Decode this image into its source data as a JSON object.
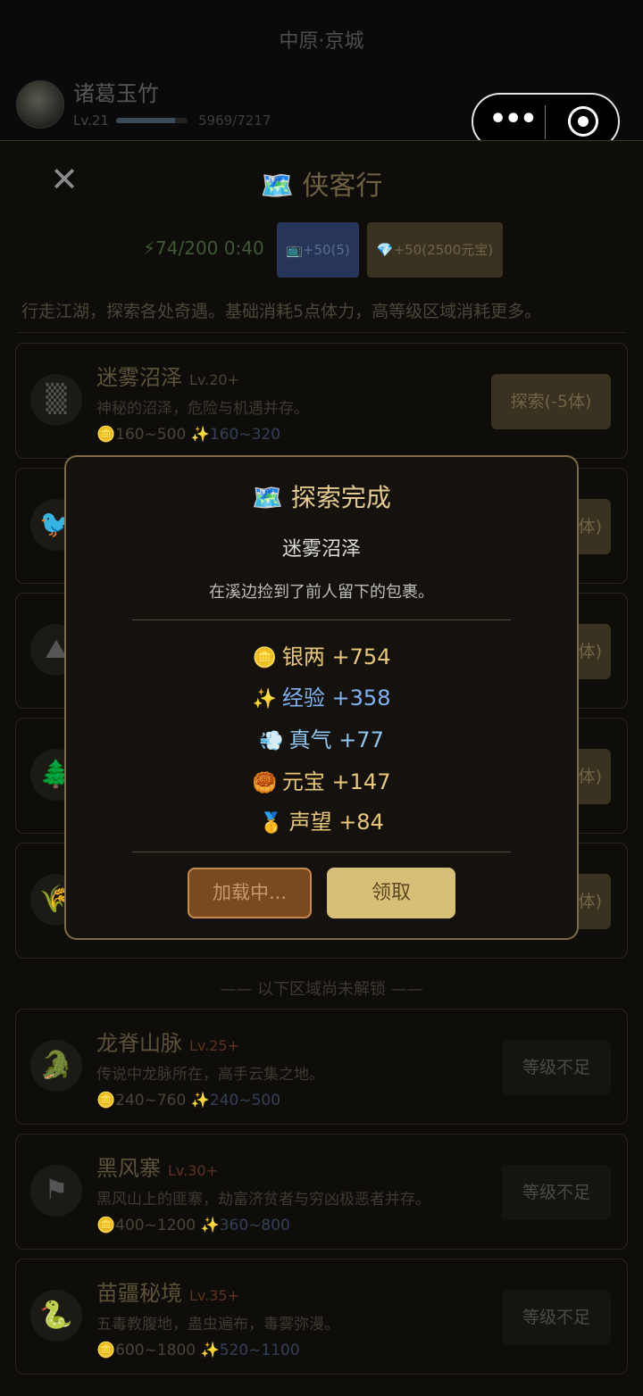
{
  "header": {
    "location": "中原·京城",
    "player_name": "诸葛玉竹",
    "level": "Lv.21",
    "xp_text": "5969/7217",
    "xp_progress": 0.827
  },
  "panel": {
    "close_icon": "✕",
    "title": "🗺️ 侠客行",
    "stamina": "⚡74/200 0:40",
    "tv_button": "📺+50(5)",
    "gem_button": "💎+50(2500元宝)",
    "description": "行走江湖，探索各处奇遇。基础消耗5点体力，高等级区域消耗更多。"
  },
  "regions": [
    {
      "name": "迷雾沼泽",
      "level": "Lv.20+",
      "desc": "神秘的沼泽，危险与机遇并存。",
      "silver": "🪙160~500",
      "exp": "✨160~320",
      "action": "探索(-5体)",
      "icon": "fog-icon"
    },
    {
      "action": "体)",
      "icon": "bird-icon"
    },
    {
      "action": "体)",
      "icon": "mountain-icon"
    },
    {
      "action": "体)",
      "icon": "tree-icon"
    },
    {
      "action": "体)",
      "icon": "wheat-icon"
    }
  ],
  "locked_label": "—— 以下区域尚未解锁 ——",
  "locked_regions": [
    {
      "name": "龙脊山脉",
      "level": "Lv.25+",
      "desc": "传说中龙脉所在，高手云集之地。",
      "silver": "🪙240~760",
      "exp": "✨240~500",
      "action": "等级不足",
      "icon": "dragon-icon"
    },
    {
      "name": "黑风寨",
      "level": "Lv.30+",
      "desc": "黑风山上的匪寨，劫富济贫者与穷凶极恶者并存。",
      "silver": "🪙400~1200",
      "exp": "✨360~800",
      "action": "等级不足",
      "icon": "black-flag-icon"
    },
    {
      "name": "苗疆秘境",
      "level": "Lv.35+",
      "desc": "五毒教腹地，蛊虫遍布，毒雾弥漫。",
      "silver": "🪙600~1800",
      "exp": "✨520~1100",
      "action": "等级不足",
      "icon": "snake-icon"
    }
  ],
  "modal": {
    "title": "🗺️ 探索完成",
    "region": "迷雾沼泽",
    "event": "在溪边捡到了前人留下的包裹。",
    "rewards": [
      {
        "icon": "🪙",
        "text": "银两 +754"
      },
      {
        "icon": "✨",
        "text": "经验 +358"
      },
      {
        "icon": "💨",
        "text": "真气 +77"
      },
      {
        "icon": "🥮",
        "text": "元宝 +147"
      },
      {
        "icon": "🥇",
        "text": "声望 +84"
      }
    ],
    "loading_button": "加载中...",
    "claim_button": "领取"
  },
  "colors": {
    "accent": "#d8bf78",
    "modal_border": "#7d6a45",
    "exp_blue": "#7fb2f0",
    "gold": "#e8c779"
  }
}
